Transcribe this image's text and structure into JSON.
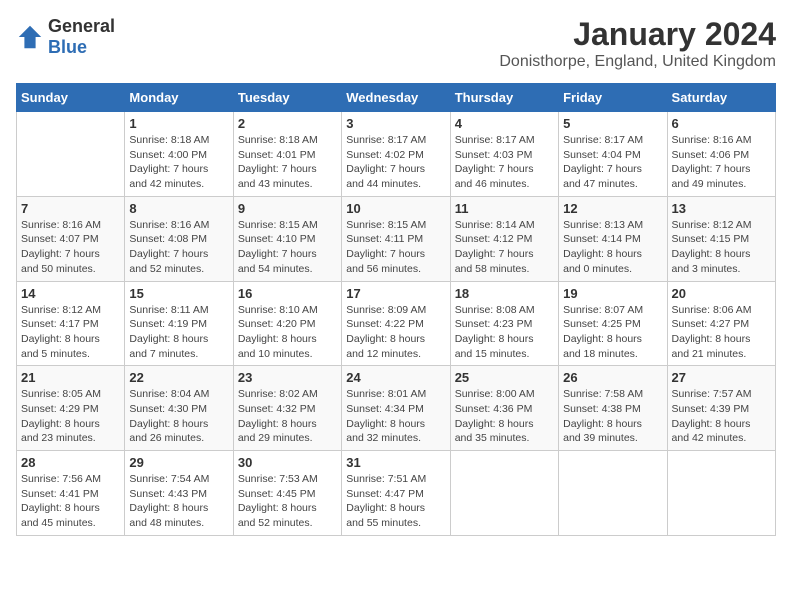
{
  "header": {
    "logo": {
      "general": "General",
      "blue": "Blue"
    },
    "month": "January 2024",
    "location": "Donisthorpe, England, United Kingdom"
  },
  "weekdays": [
    "Sunday",
    "Monday",
    "Tuesday",
    "Wednesday",
    "Thursday",
    "Friday",
    "Saturday"
  ],
  "weeks": [
    [
      {
        "day": "",
        "info": ""
      },
      {
        "day": "1",
        "info": "Sunrise: 8:18 AM\nSunset: 4:00 PM\nDaylight: 7 hours\nand 42 minutes."
      },
      {
        "day": "2",
        "info": "Sunrise: 8:18 AM\nSunset: 4:01 PM\nDaylight: 7 hours\nand 43 minutes."
      },
      {
        "day": "3",
        "info": "Sunrise: 8:17 AM\nSunset: 4:02 PM\nDaylight: 7 hours\nand 44 minutes."
      },
      {
        "day": "4",
        "info": "Sunrise: 8:17 AM\nSunset: 4:03 PM\nDaylight: 7 hours\nand 46 minutes."
      },
      {
        "day": "5",
        "info": "Sunrise: 8:17 AM\nSunset: 4:04 PM\nDaylight: 7 hours\nand 47 minutes."
      },
      {
        "day": "6",
        "info": "Sunrise: 8:16 AM\nSunset: 4:06 PM\nDaylight: 7 hours\nand 49 minutes."
      }
    ],
    [
      {
        "day": "7",
        "info": "Sunrise: 8:16 AM\nSunset: 4:07 PM\nDaylight: 7 hours\nand 50 minutes."
      },
      {
        "day": "8",
        "info": "Sunrise: 8:16 AM\nSunset: 4:08 PM\nDaylight: 7 hours\nand 52 minutes."
      },
      {
        "day": "9",
        "info": "Sunrise: 8:15 AM\nSunset: 4:10 PM\nDaylight: 7 hours\nand 54 minutes."
      },
      {
        "day": "10",
        "info": "Sunrise: 8:15 AM\nSunset: 4:11 PM\nDaylight: 7 hours\nand 56 minutes."
      },
      {
        "day": "11",
        "info": "Sunrise: 8:14 AM\nSunset: 4:12 PM\nDaylight: 7 hours\nand 58 minutes."
      },
      {
        "day": "12",
        "info": "Sunrise: 8:13 AM\nSunset: 4:14 PM\nDaylight: 8 hours\nand 0 minutes."
      },
      {
        "day": "13",
        "info": "Sunrise: 8:12 AM\nSunset: 4:15 PM\nDaylight: 8 hours\nand 3 minutes."
      }
    ],
    [
      {
        "day": "14",
        "info": "Sunrise: 8:12 AM\nSunset: 4:17 PM\nDaylight: 8 hours\nand 5 minutes."
      },
      {
        "day": "15",
        "info": "Sunrise: 8:11 AM\nSunset: 4:19 PM\nDaylight: 8 hours\nand 7 minutes."
      },
      {
        "day": "16",
        "info": "Sunrise: 8:10 AM\nSunset: 4:20 PM\nDaylight: 8 hours\nand 10 minutes."
      },
      {
        "day": "17",
        "info": "Sunrise: 8:09 AM\nSunset: 4:22 PM\nDaylight: 8 hours\nand 12 minutes."
      },
      {
        "day": "18",
        "info": "Sunrise: 8:08 AM\nSunset: 4:23 PM\nDaylight: 8 hours\nand 15 minutes."
      },
      {
        "day": "19",
        "info": "Sunrise: 8:07 AM\nSunset: 4:25 PM\nDaylight: 8 hours\nand 18 minutes."
      },
      {
        "day": "20",
        "info": "Sunrise: 8:06 AM\nSunset: 4:27 PM\nDaylight: 8 hours\nand 21 minutes."
      }
    ],
    [
      {
        "day": "21",
        "info": "Sunrise: 8:05 AM\nSunset: 4:29 PM\nDaylight: 8 hours\nand 23 minutes."
      },
      {
        "day": "22",
        "info": "Sunrise: 8:04 AM\nSunset: 4:30 PM\nDaylight: 8 hours\nand 26 minutes."
      },
      {
        "day": "23",
        "info": "Sunrise: 8:02 AM\nSunset: 4:32 PM\nDaylight: 8 hours\nand 29 minutes."
      },
      {
        "day": "24",
        "info": "Sunrise: 8:01 AM\nSunset: 4:34 PM\nDaylight: 8 hours\nand 32 minutes."
      },
      {
        "day": "25",
        "info": "Sunrise: 8:00 AM\nSunset: 4:36 PM\nDaylight: 8 hours\nand 35 minutes."
      },
      {
        "day": "26",
        "info": "Sunrise: 7:58 AM\nSunset: 4:38 PM\nDaylight: 8 hours\nand 39 minutes."
      },
      {
        "day": "27",
        "info": "Sunrise: 7:57 AM\nSunset: 4:39 PM\nDaylight: 8 hours\nand 42 minutes."
      }
    ],
    [
      {
        "day": "28",
        "info": "Sunrise: 7:56 AM\nSunset: 4:41 PM\nDaylight: 8 hours\nand 45 minutes."
      },
      {
        "day": "29",
        "info": "Sunrise: 7:54 AM\nSunset: 4:43 PM\nDaylight: 8 hours\nand 48 minutes."
      },
      {
        "day": "30",
        "info": "Sunrise: 7:53 AM\nSunset: 4:45 PM\nDaylight: 8 hours\nand 52 minutes."
      },
      {
        "day": "31",
        "info": "Sunrise: 7:51 AM\nSunset: 4:47 PM\nDaylight: 8 hours\nand 55 minutes."
      },
      {
        "day": "",
        "info": ""
      },
      {
        "day": "",
        "info": ""
      },
      {
        "day": "",
        "info": ""
      }
    ]
  ]
}
